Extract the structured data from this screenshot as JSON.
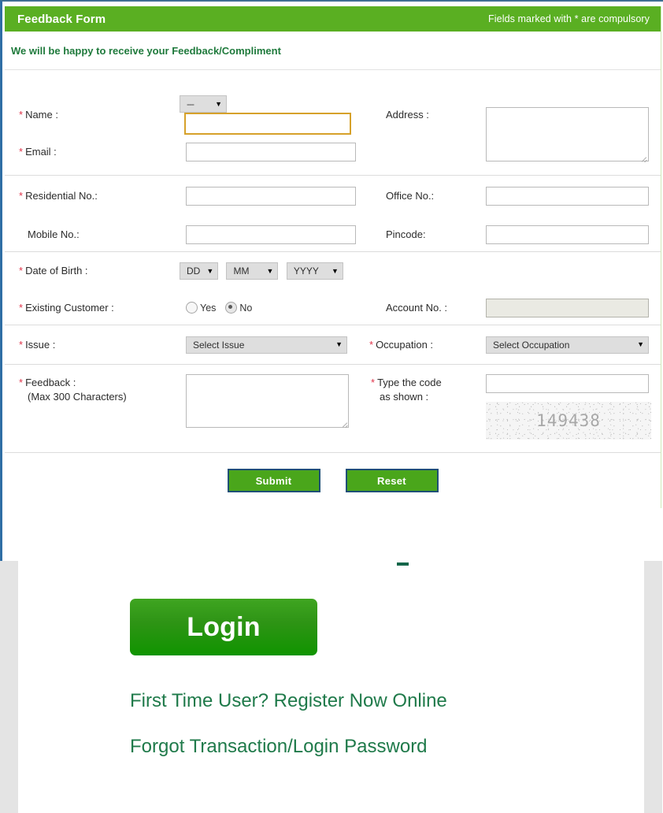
{
  "form": {
    "header_title": "Feedback Form",
    "header_note": "Fields marked with * are compulsory",
    "subtitle": "We will be happy to receive your Feedback/Compliment",
    "required_marker": "*",
    "caret": "▼",
    "fields": {
      "name_label": "Name :",
      "name_title_value": "---",
      "name_value": "",
      "address_label": "Address :",
      "address_value": "",
      "email_label": "Email :",
      "email_value": "",
      "residential_label": "Residential No.:",
      "residential_value": "",
      "office_label": "Office No.:",
      "office_value": "",
      "mobile_label": "Mobile No.:",
      "mobile_value": "",
      "pincode_label": "Pincode:",
      "pincode_value": "",
      "dob_label": "Date of Birth :",
      "dob_day": "DD",
      "dob_month": "MM",
      "dob_year": "YYYY",
      "existing_customer_label": "Existing Customer :",
      "radio_yes_label": "Yes",
      "radio_no_label": "No",
      "existing_customer_selected": "No",
      "account_label": "Account No. :",
      "account_value": "",
      "issue_label": "Issue :",
      "issue_value": "Select Issue",
      "occupation_label": "Occupation :",
      "occupation_value": "Select Occupation",
      "feedback_label": "Feedback :",
      "feedback_label_2": "(Max 300 Characters)",
      "feedback_value": "",
      "captcha_label": "Type the code",
      "captcha_label_2": "as shown :",
      "captcha_input_value": "",
      "captcha_code": "149438"
    },
    "buttons": {
      "submit": "Submit",
      "reset": "Reset"
    }
  },
  "login": {
    "login_button": "Login",
    "register_link": "First Time User? Register Now Online",
    "forgot_link": "Forgot Transaction/Login Password"
  },
  "colors": {
    "header_green": "#5aaf22",
    "link_green": "#1f7a4a",
    "button_green": "#4aa61b",
    "required_red": "#e0344a",
    "focus_gold": "#d6a12a",
    "subtitle_green": "#1f7a3c"
  }
}
